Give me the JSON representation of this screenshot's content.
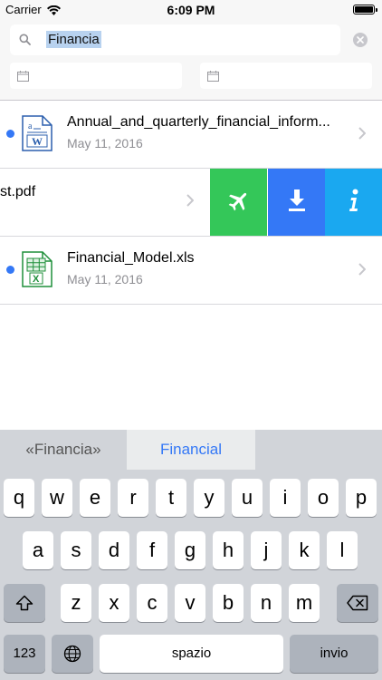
{
  "status_bar": {
    "carrier": "Carrier",
    "time": "6:09 PM"
  },
  "search": {
    "query": "Financia"
  },
  "files": [
    {
      "name": "Annual_and_quarterly_financial_inform...",
      "date": "May 11, 2016",
      "unread": true,
      "type": "doc"
    },
    {
      "name": "st.pdf",
      "date": "",
      "unread": false,
      "type": "pdf",
      "swiped": true
    },
    {
      "name": "Financial_Model.xls",
      "date": "May 11, 2016",
      "unread": true,
      "type": "xls"
    }
  ],
  "row_actions": [
    "airplane-icon",
    "download-icon",
    "info-icon"
  ],
  "colors": {
    "accent": "#3478f6",
    "action_green": "#34c759",
    "action_blue": "#3478f6",
    "action_cyan": "#1aa8f0"
  },
  "keyboard": {
    "suggestions": [
      "«Financia»",
      "Financial"
    ],
    "row1": [
      "q",
      "w",
      "e",
      "r",
      "t",
      "y",
      "u",
      "i",
      "o",
      "p"
    ],
    "row2": [
      "a",
      "s",
      "d",
      "f",
      "g",
      "h",
      "j",
      "k",
      "l"
    ],
    "row3": [
      "z",
      "x",
      "c",
      "v",
      "b",
      "n",
      "m"
    ],
    "numbers_key": "123",
    "space_key": "spazio",
    "return_key": "invio"
  }
}
